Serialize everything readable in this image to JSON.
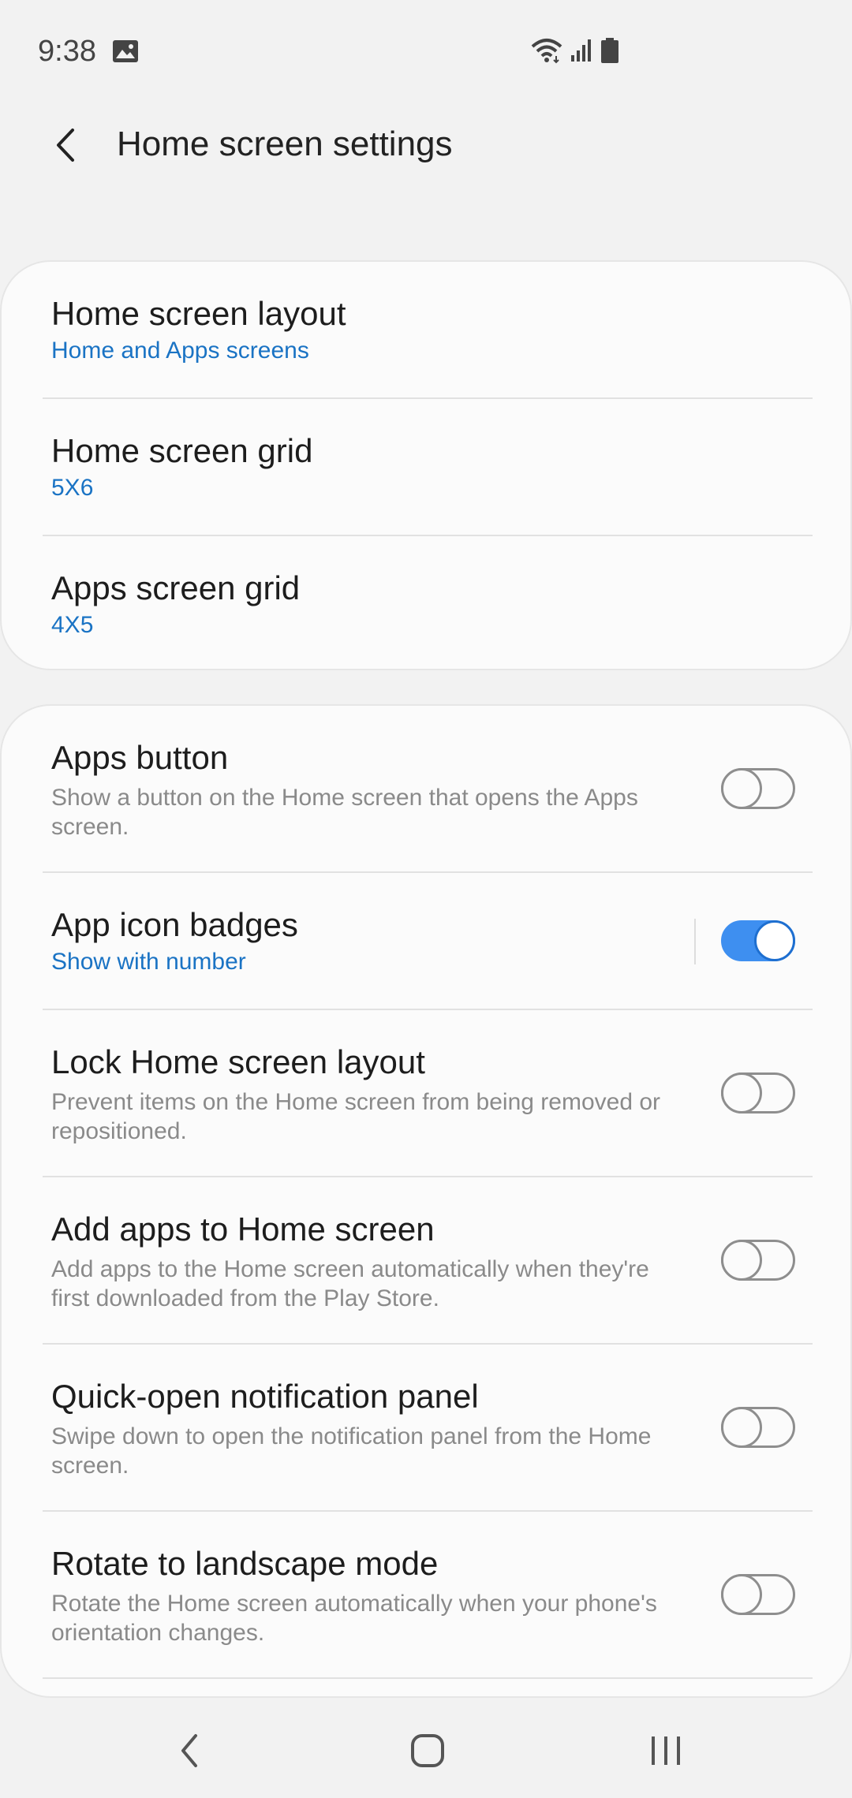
{
  "status_bar": {
    "time": "9:38",
    "icons": [
      "gallery-icon",
      "wifi-icon",
      "signal-icon",
      "battery-icon"
    ]
  },
  "header": {
    "title": "Home screen settings",
    "back_icon": "chevron-left-icon"
  },
  "section1": [
    {
      "title": "Home screen layout",
      "value": "Home and Apps screens"
    },
    {
      "title": "Home screen grid",
      "value": "5X6"
    },
    {
      "title": "Apps screen grid",
      "value": "4X5"
    }
  ],
  "section2": [
    {
      "title": "Apps button",
      "description": "Show a button on the Home screen that opens the Apps screen.",
      "toggle_on": false
    },
    {
      "title": "App icon badges",
      "value": "Show with number",
      "toggle_on": true
    },
    {
      "title": "Lock Home screen layout",
      "description": "Prevent items on the Home screen from being removed or repositioned.",
      "toggle_on": false
    },
    {
      "title": "Add apps to Home screen",
      "description": "Add apps to the Home screen automatically when they're first downloaded from the Play Store.",
      "toggle_on": false
    },
    {
      "title": "Quick-open notification panel",
      "description": "Swipe down to open the notification panel from the Home screen.",
      "toggle_on": false
    },
    {
      "title": "Rotate to landscape mode",
      "description": "Rotate the Home screen automatically when your phone's orientation changes.",
      "toggle_on": false
    }
  ],
  "nav_bar": {
    "icons": [
      "back-icon",
      "home-icon",
      "recents-icon"
    ]
  },
  "colors": {
    "accent": "#3e8ff0",
    "link": "#1a73c4",
    "background": "#f2f2f2",
    "card": "#fbfbfb"
  }
}
